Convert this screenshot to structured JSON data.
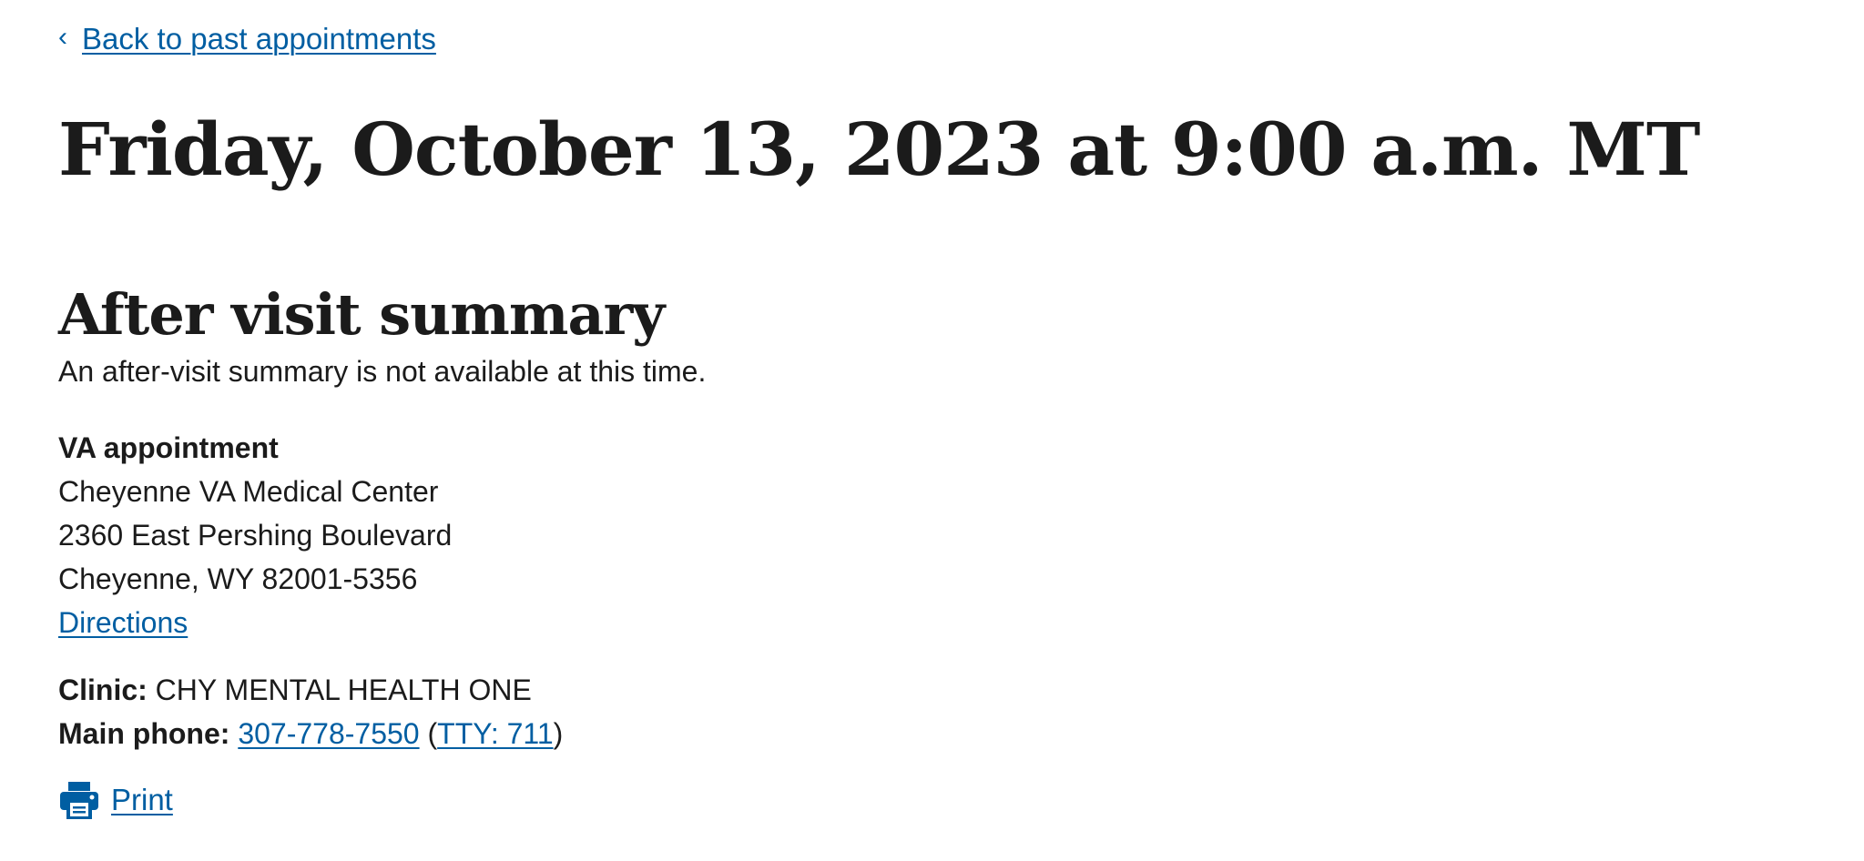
{
  "nav": {
    "back_chevron": "‹",
    "back_label": "Back to past appointments"
  },
  "header": {
    "title": "Friday, October 13, 2023 at 9:00 a.m. MT"
  },
  "after_visit": {
    "heading": "After visit summary",
    "message": "An after-visit summary is not available at this time."
  },
  "appointment": {
    "type_label": "VA appointment",
    "facility": "Cheyenne VA Medical Center",
    "address_line1": "2360 East Pershing Boulevard",
    "address_line2": "Cheyenne, WY 82001-5356",
    "directions_label": "Directions"
  },
  "clinic": {
    "label": "Clinic:",
    "value": "CHY MENTAL HEALTH ONE"
  },
  "phone": {
    "label": "Main phone:",
    "number": "307-778-7550",
    "open_paren": "(",
    "tty": "TTY: 711",
    "close_paren": ")"
  },
  "actions": {
    "print_label": "Print",
    "print_icon": "printer-icon"
  },
  "colors": {
    "link": "#005ea2",
    "text": "#1b1b1b",
    "background": "#ffffff"
  }
}
